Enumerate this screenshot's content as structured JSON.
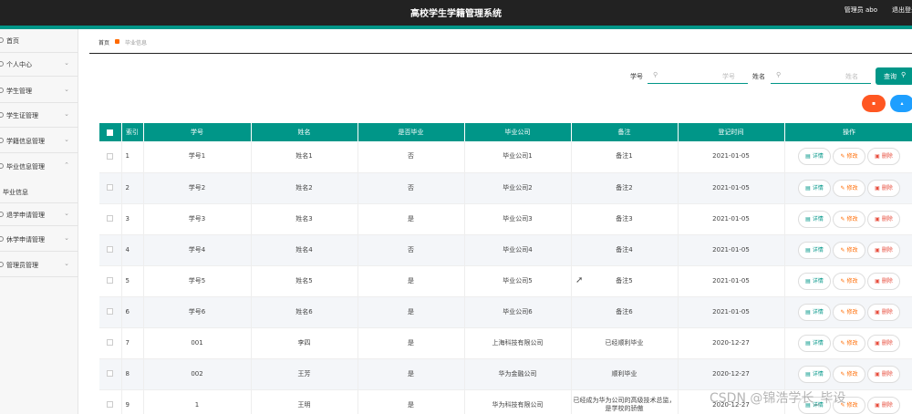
{
  "app": {
    "title": "高校学生学籍管理系统",
    "user": "管理员 abo",
    "logout": "退出登录"
  },
  "sidebar": {
    "items": [
      {
        "label": "首页",
        "name": "home",
        "chevron": ""
      },
      {
        "label": "个人中心",
        "name": "personal-center",
        "chevron": "⌄"
      },
      {
        "label": "学生管理",
        "name": "student-management",
        "chevron": "⌄"
      },
      {
        "label": "学生证管理",
        "name": "student-card-management",
        "chevron": "⌄"
      },
      {
        "label": "学籍信息管理",
        "name": "enrollment-info-management",
        "chevron": "⌄"
      },
      {
        "label": "毕业信息管理",
        "name": "graduation-info-management",
        "chevron": "⌃"
      }
    ],
    "sub_item": "毕业信息",
    "items_bottom": [
      {
        "label": "退学申请管理",
        "name": "dropout-management",
        "chevron": "⌄"
      },
      {
        "label": "休学申请管理",
        "name": "suspension-management",
        "chevron": "⌄"
      },
      {
        "label": "管理员管理",
        "name": "admin-management",
        "chevron": "⌄"
      }
    ]
  },
  "breadcrumb": {
    "home": "首页",
    "current": "毕业信息"
  },
  "search": {
    "label_id": "学号",
    "placeholder_id": "学号",
    "label_name": "姓名",
    "placeholder_name": "姓名",
    "query_label": "查询",
    "query_icon": "⚲"
  },
  "actions": {
    "delete_color": "#ff5722",
    "add_color": "#1e9fff"
  },
  "table": {
    "headers": [
      "索引",
      "学号",
      "姓名",
      "是否毕业",
      "毕业公司",
      "备注",
      "登记时间",
      "操作"
    ],
    "rows": [
      [
        "1",
        "学号1",
        "姓名1",
        "否",
        "毕业公司1",
        "备注1",
        "2021-01-05"
      ],
      [
        "2",
        "学号2",
        "姓名2",
        "否",
        "毕业公司2",
        "备注2",
        "2021-01-05"
      ],
      [
        "3",
        "学号3",
        "姓名3",
        "是",
        "毕业公司3",
        "备注3",
        "2021-01-05"
      ],
      [
        "4",
        "学号4",
        "姓名4",
        "否",
        "毕业公司4",
        "备注4",
        "2021-01-05"
      ],
      [
        "5",
        "学号5",
        "姓名5",
        "是",
        "毕业公司5",
        "备注5",
        "2021-01-05"
      ],
      [
        "6",
        "学号6",
        "姓名6",
        "是",
        "毕业公司6",
        "备注6",
        "2021-01-05"
      ],
      [
        "7",
        "001",
        "李四",
        "是",
        "上海科技有限公司",
        "已经顺利毕业",
        "2020-12-27"
      ],
      [
        "8",
        "002",
        "王芳",
        "是",
        "华为金融公司",
        "顺利毕业",
        "2020-12-27"
      ],
      [
        "9",
        "1",
        "王明",
        "是",
        "华为科技有限公司",
        "已经成为华为公司的高级技术总监，是学校的骄傲",
        "2020-12-27"
      ]
    ],
    "op_labels": {
      "detail": "详情",
      "edit": "修改",
      "delete": "删除"
    }
  },
  "watermark": "CSDN @锦浩学长_毕设",
  "colors": {
    "primary": "#009688",
    "topbar": "#222222"
  }
}
